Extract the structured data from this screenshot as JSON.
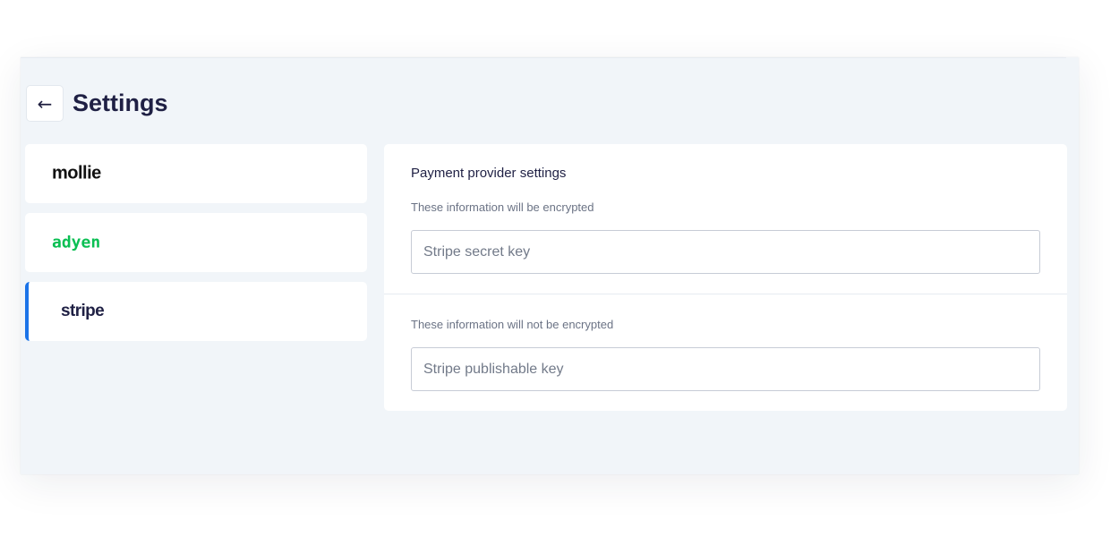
{
  "header": {
    "back_icon": "←",
    "title": "Settings"
  },
  "providers": [
    {
      "name": "mollie",
      "logo_text": "mollie",
      "logo_color": "#111111",
      "active": false
    },
    {
      "name": "adyen",
      "logo_text": "adyen",
      "logo_color": "#0abf53",
      "active": false
    },
    {
      "name": "stripe",
      "logo_text": "stripe",
      "logo_color": "#1f2044",
      "active": true
    }
  ],
  "panel": {
    "title": "Payment provider settings",
    "sections": [
      {
        "note": "These information will be encrypted",
        "field": {
          "value": "",
          "placeholder": "Stripe secret key"
        }
      },
      {
        "note": "These information will not be encrypted",
        "field": {
          "value": "",
          "placeholder": "Stripe publishable key"
        }
      }
    ]
  },
  "colors": {
    "background": "#f1f5f9",
    "accent": "#1a73e8",
    "title": "#1f2044"
  }
}
